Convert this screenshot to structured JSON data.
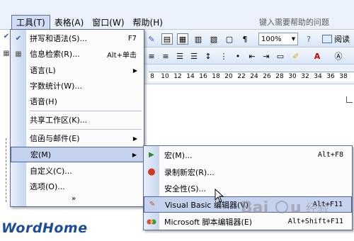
{
  "menubar": {
    "items": [
      "工具(T)",
      "表格(A)",
      "窗口(W)",
      "帮助(H)"
    ],
    "active_index": 0,
    "help_placeholder": "键入需要帮助的问题"
  },
  "toolbar": {
    "zoom": "100%",
    "read_label": "阅读"
  },
  "ruler": {
    "numbers": [
      "8",
      "10",
      "12",
      "14",
      "16",
      "18",
      "20",
      "22",
      "24",
      "26",
      "28",
      "30",
      "32",
      "34",
      "36",
      "38"
    ]
  },
  "tools_menu": {
    "items": [
      {
        "label": "拼写和语法(S)...",
        "shortcut": "F7",
        "icon": "spellcheck-icon",
        "submenu": false
      },
      {
        "label": "信息检索(R)...",
        "shortcut": "Alt+单击",
        "icon": "research-icon",
        "submenu": false
      },
      {
        "label": "语言(L)",
        "shortcut": "",
        "icon": "",
        "submenu": true
      },
      {
        "label": "字数统计(W)...",
        "shortcut": "",
        "icon": "",
        "submenu": false
      },
      {
        "label": "语音(H)",
        "shortcut": "",
        "icon": "",
        "submenu": false
      },
      {
        "label": "共享工作区(K)...",
        "shortcut": "",
        "icon": "",
        "submenu": false
      },
      {
        "label": "信函与邮件(E)",
        "shortcut": "",
        "icon": "",
        "submenu": true
      },
      {
        "label": "宏(M)",
        "shortcut": "",
        "icon": "",
        "submenu": true
      },
      {
        "label": "自定义(C)...",
        "shortcut": "",
        "icon": "",
        "submenu": false
      },
      {
        "label": "选项(O)...",
        "shortcut": "",
        "icon": "",
        "submenu": false
      }
    ],
    "highlighted_index": 7
  },
  "macro_menu": {
    "items": [
      {
        "label": "宏(M)...",
        "shortcut": "Alt+F8",
        "icon": "run-macro-icon"
      },
      {
        "label": "录制新宏(R)...",
        "shortcut": "",
        "icon": "record-macro-icon"
      },
      {
        "label": "安全性(S)...",
        "shortcut": "",
        "icon": ""
      },
      {
        "label": "Visual Basic 编辑器(V)",
        "shortcut": "Alt+F11",
        "icon": "vb-editor-icon"
      },
      {
        "label": "Microsoft 脚本编辑器(E)",
        "shortcut": "Alt+Shift+F11",
        "icon": "script-editor-icon"
      }
    ],
    "highlighted_index": 3
  },
  "watermarks": {
    "wordhome": "WordHome",
    "baidu": "Baidu 经验"
  },
  "colors": {
    "menu_highlight": "#c4d2ee",
    "menu_border": "#4b63a0",
    "wordhome_blue": "#1c4c9b"
  }
}
